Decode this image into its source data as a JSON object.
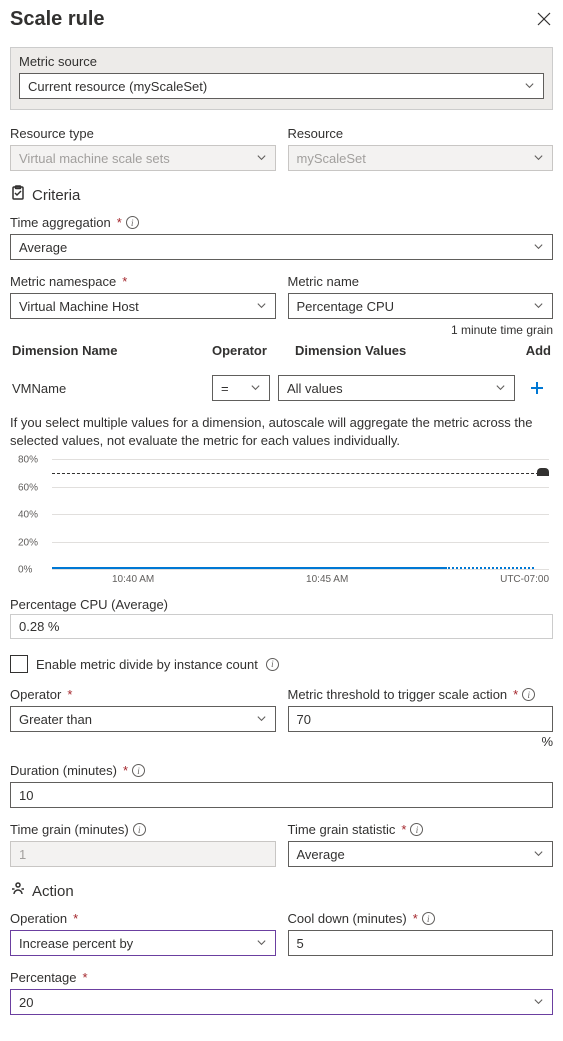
{
  "title": "Scale rule",
  "metric_source": {
    "label": "Metric source",
    "value": "Current resource (myScaleSet)"
  },
  "resource_type": {
    "label": "Resource type",
    "value": "Virtual machine scale sets"
  },
  "resource": {
    "label": "Resource",
    "value": "myScaleSet"
  },
  "criteria_header": "Criteria",
  "time_aggregation": {
    "label": "Time aggregation",
    "value": "Average"
  },
  "metric_namespace": {
    "label": "Metric namespace",
    "value": "Virtual Machine Host"
  },
  "metric_name": {
    "label": "Metric name",
    "value": "Percentage CPU"
  },
  "time_grain_note": "1 minute time grain",
  "dimension": {
    "headers": {
      "name": "Dimension Name",
      "operator": "Operator",
      "values": "Dimension Values",
      "add": "Add"
    },
    "row": {
      "name": "VMName",
      "operator": "=",
      "values": "All values"
    }
  },
  "dimension_note": "If you select multiple values for a dimension, autoscale will aggregate the metric across the selected values, not evaluate the metric for each values individually.",
  "chart_data": {
    "type": "line",
    "title": "",
    "ylabel": "",
    "xlabel": "",
    "ylim": [
      0,
      80
    ],
    "y_ticks": [
      "0%",
      "20%",
      "40%",
      "60%",
      "80%"
    ],
    "threshold_line": 70,
    "x_ticks": [
      "10:40 AM",
      "10:45 AM"
    ],
    "timezone": "UTC-07:00",
    "series": [
      {
        "name": "Percentage CPU",
        "values_approx": "flat near 0% across range"
      }
    ]
  },
  "cpu_summary": {
    "label": "Percentage CPU (Average)",
    "value": "0.28 %"
  },
  "enable_divide": {
    "label": "Enable metric divide by instance count",
    "checked": false
  },
  "operator": {
    "label": "Operator",
    "value": "Greater than"
  },
  "threshold": {
    "label": "Metric threshold to trigger scale action",
    "value": "70",
    "unit": "%"
  },
  "duration": {
    "label": "Duration (minutes)",
    "value": "10"
  },
  "time_grain_min": {
    "label": "Time grain (minutes)",
    "value": "1"
  },
  "time_grain_stat": {
    "label": "Time grain statistic",
    "value": "Average"
  },
  "action_header": "Action",
  "operation": {
    "label": "Operation",
    "value": "Increase percent by"
  },
  "cool_down": {
    "label": "Cool down (minutes)",
    "value": "5"
  },
  "percentage": {
    "label": "Percentage",
    "value": "20"
  }
}
